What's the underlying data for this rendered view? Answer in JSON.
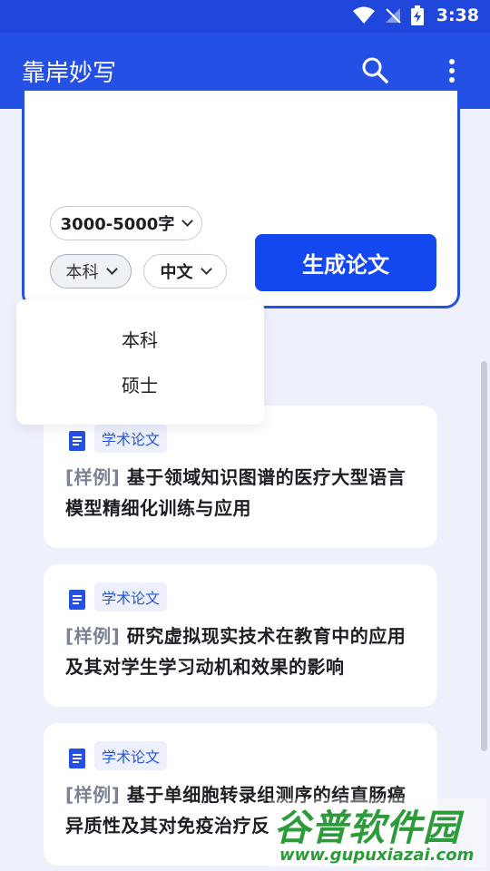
{
  "status_bar": {
    "time": "3:38"
  },
  "app_bar": {
    "title": "靠岸妙写"
  },
  "generator": {
    "word_count": "3000-5000字",
    "degree": "本科",
    "language": "中文",
    "generate_label": "生成论文"
  },
  "dropdown": {
    "options": [
      "本科",
      "硕士"
    ]
  },
  "samples": [
    {
      "tag": "学术论文",
      "prefix": "[样例]",
      "title": "基于领域知识图谱的医疗大型语言模型精细化训练与应用"
    },
    {
      "tag": "学术论文",
      "prefix": "[样例]",
      "title": "研究虚拟现实技术在教育中的应用及其对学生学习动机和效果的影响"
    },
    {
      "tag": "学术论文",
      "prefix": "[样例]",
      "title": "基于单细胞转录组测序的结直肠癌异质性及其对免疫治疗反"
    }
  ],
  "watermark": {
    "name": "谷普软件园",
    "url": "www.gupuxiazai.com"
  },
  "colors": {
    "primary": "#2550e6",
    "button": "#1347f0",
    "tag_text": "#2a55d8"
  }
}
